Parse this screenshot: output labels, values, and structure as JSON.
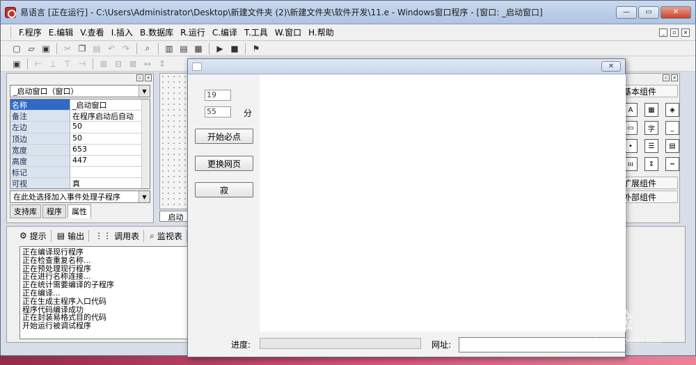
{
  "ide": {
    "title": "易语言 [正在运行] - C:\\Users\\Administrator\\Desktop\\新建文件夹 (2)\\新建文件夹\\软件开发\\11.e - Windows窗口程序 - [窗口: _启动窗口]",
    "window_buttons": [
      "—",
      "▭",
      "✕"
    ],
    "menu": [
      "F.程序",
      "E.编辑",
      "V.查看",
      "I.插入",
      "B.数据库",
      "R.运行",
      "C.编译",
      "T.工具",
      "W.窗口",
      "H.帮助"
    ]
  },
  "properties": {
    "object_selector": "_启动窗口（窗口）",
    "rows": [
      {
        "key": "名称",
        "value": "_启动窗口"
      },
      {
        "key": "备注",
        "value": "在程序启动后自动"
      },
      {
        "key": "左边",
        "value": "50"
      },
      {
        "key": "顶边",
        "value": "50"
      },
      {
        "key": "宽度",
        "value": "653"
      },
      {
        "key": "高度",
        "value": "447"
      },
      {
        "key": "标记",
        "value": ""
      },
      {
        "key": "可视",
        "value": "真"
      }
    ],
    "event_selector": "在此处选择加入事件处理子程序",
    "tabs": [
      "支持库",
      "程序",
      "属性"
    ],
    "selected_row": 0
  },
  "design": {
    "doc_tab": "_启动"
  },
  "components": {
    "sections": [
      "基本组件",
      "扩展组件",
      "外部组件"
    ],
    "icons": [
      "label-icon",
      "picture-icon",
      "shape-icon",
      "edit-icon",
      "text-icon",
      "line-icon",
      "radio-icon",
      "list-icon",
      "table-icon",
      "dial-icon",
      "spin-icon",
      "bar-icon"
    ],
    "glyphs": [
      "A",
      "▦",
      "◈",
      "▭",
      "字",
      "_",
      "•",
      "☰",
      "▤",
      "ııı",
      "⇕",
      "┅"
    ]
  },
  "output": {
    "tabs": [
      "提示",
      "输出",
      "调用表",
      "监视表"
    ],
    "lines": [
      "正在编译现行程序",
      "正在检查重复名称...",
      "正在预处理现行程序",
      "正在进行名称连接...",
      "正在统计需要编译的子程序",
      "正在编译...",
      "正在生成主程序入口代码",
      "程序代码编译成功",
      "正在封装易格式目的代码",
      "开始运行被调试程序"
    ]
  },
  "app": {
    "input1": "19",
    "input2": "55",
    "unit_label": "分",
    "btn_start": "开始必点",
    "btn_change": "更换网页",
    "btn_third": "寂",
    "progress_label": "进度:",
    "progress_value": 0,
    "url_label": "网址:",
    "url_value": ""
  },
  "watermark": {
    "brand": "Baidu经验",
    "url": "jingyan.baidu.com"
  }
}
